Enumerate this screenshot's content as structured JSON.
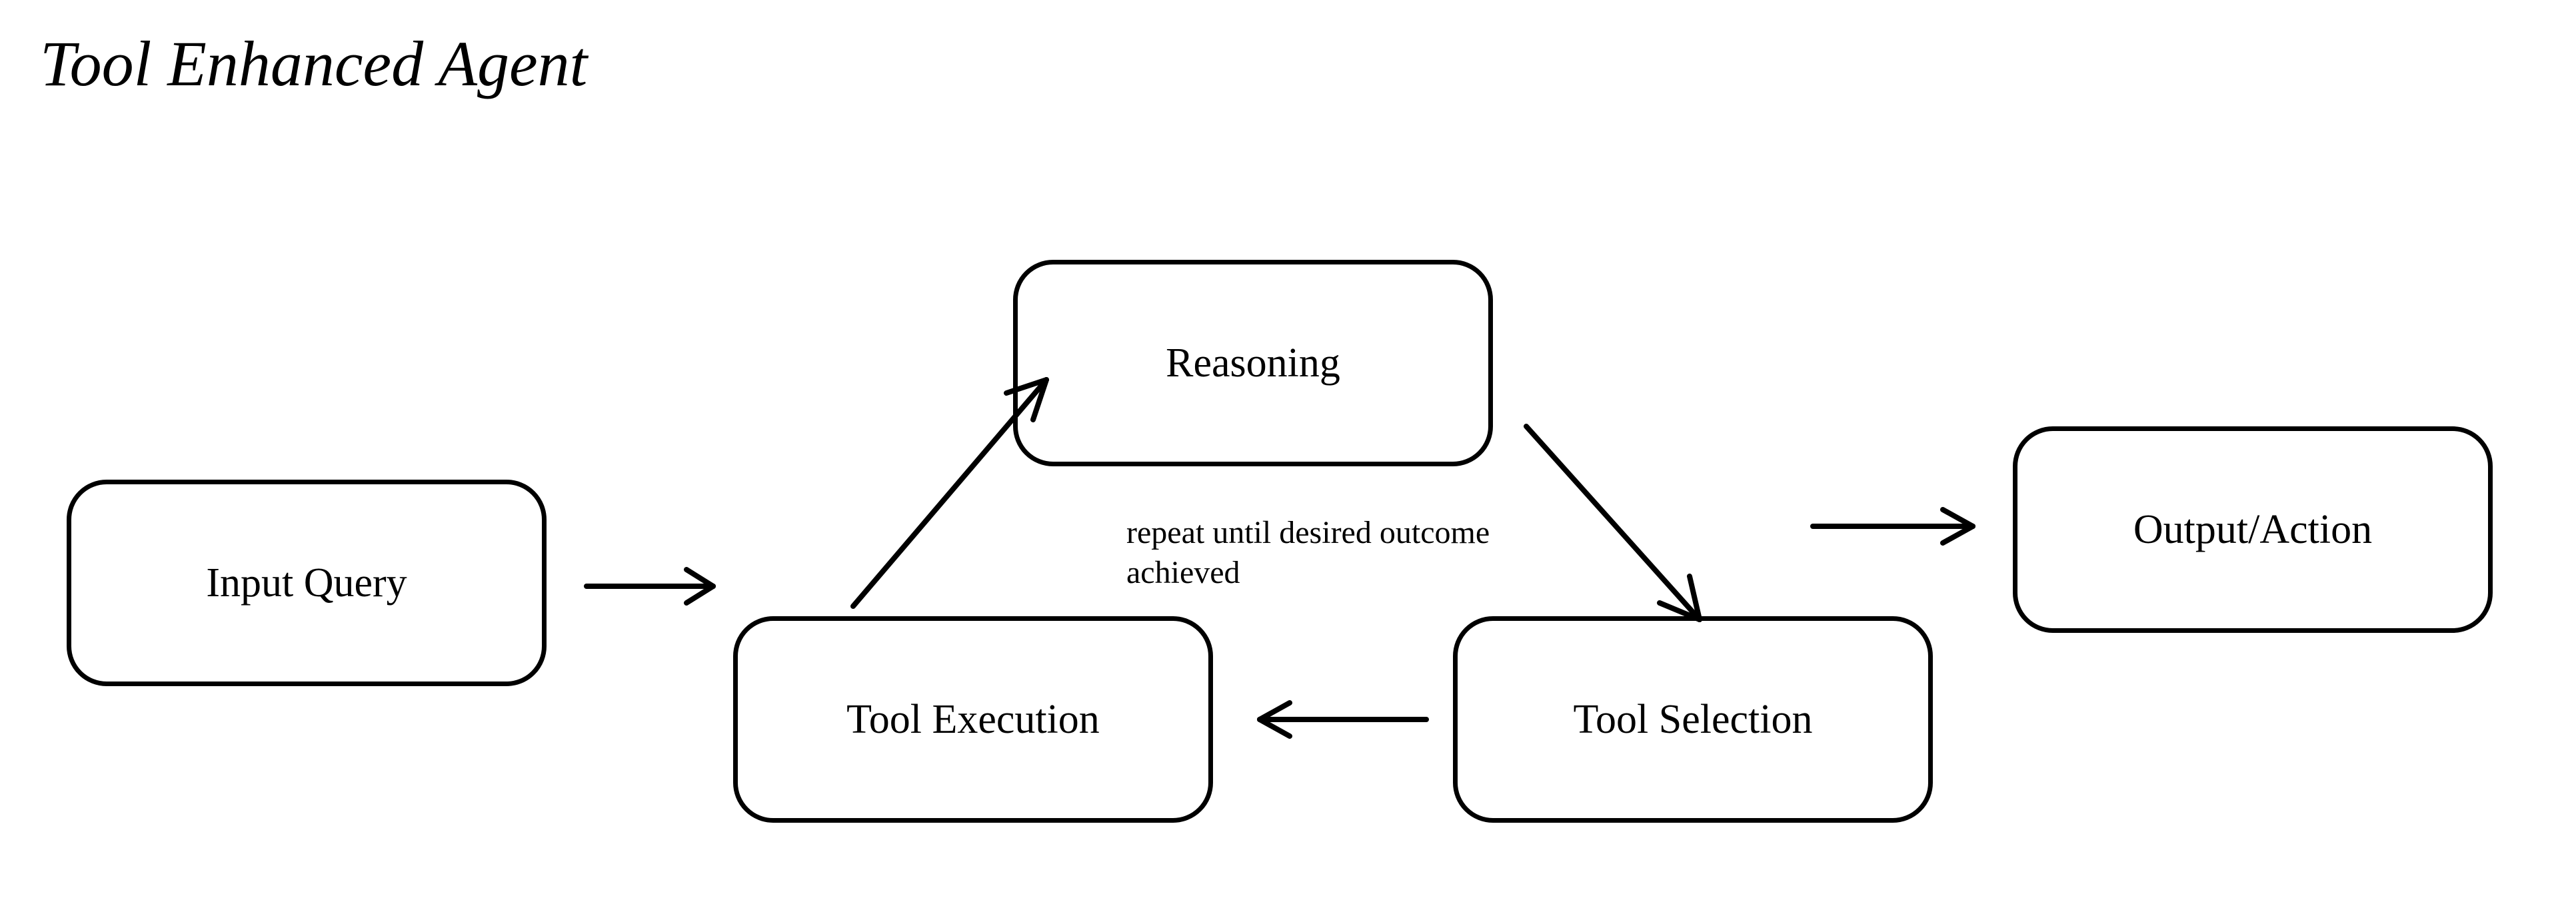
{
  "title": "Tool Enhanced Agent",
  "nodes": {
    "input": {
      "label": "Input Query"
    },
    "reason": {
      "label": "Reasoning"
    },
    "toolsel": {
      "label": "Tool Selection"
    },
    "toolexec": {
      "label": "Tool Execution"
    },
    "output": {
      "label": "Output/Action"
    }
  },
  "loop_label": "repeat until desired outcome achieved",
  "edges": [
    {
      "from": "input",
      "to": "reason"
    },
    {
      "from": "reason",
      "to": "toolsel"
    },
    {
      "from": "toolsel",
      "to": "toolexec"
    },
    {
      "from": "toolexec",
      "to": "reason"
    },
    {
      "from": "loop",
      "to": "output"
    }
  ]
}
